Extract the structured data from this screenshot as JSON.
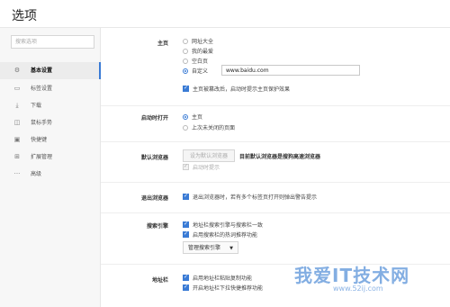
{
  "header": {
    "title": "选项"
  },
  "sidebar": {
    "search_placeholder": "搜索选项",
    "items": [
      {
        "icon": "gear-icon",
        "glyph": "⚙",
        "label": "基本设置",
        "active": true
      },
      {
        "icon": "tab-icon",
        "glyph": "▭",
        "label": "标签设置",
        "active": false
      },
      {
        "icon": "download-icon",
        "glyph": "⤓",
        "label": "下载",
        "active": false
      },
      {
        "icon": "mouse-icon",
        "glyph": "◫",
        "label": "鼠标手势",
        "active": false
      },
      {
        "icon": "keyboard-icon",
        "glyph": "▣",
        "label": "快捷键",
        "active": false
      },
      {
        "icon": "extension-icon",
        "glyph": "⊞",
        "label": "扩展管理",
        "active": false
      },
      {
        "icon": "more-icon",
        "glyph": "···",
        "label": "高级",
        "active": false
      }
    ]
  },
  "homepage": {
    "label": "主页",
    "options": [
      "网址大全",
      "我的最爱",
      "空白页",
      "自定义"
    ],
    "selected": "自定义",
    "url_value": "www.baidu.com",
    "protect_label": "主页被篡改后，启动时提示主页保护效果",
    "protect_checked": true
  },
  "startup": {
    "label": "启动时打开",
    "options": [
      "主页",
      "上次未关闭的页面"
    ],
    "selected": "主页"
  },
  "default_browser": {
    "label": "默认浏览器",
    "button_label": "设为默认浏览器",
    "status_text": "目前默认浏览器是搜狗高速浏览器",
    "startup_check_label": "启动时提示",
    "startup_check_checked": false
  },
  "exit_browser": {
    "label": "退出浏览器",
    "check_label": "退出浏览器时，若有多个标签页打开则弹出警告提示",
    "checked": true
  },
  "search_engine": {
    "label": "搜索引擎",
    "check1_label": "地址栏搜索引擎与搜索栏一致",
    "check1_checked": true,
    "check2_label": "启用搜索栏的热词推荐功能",
    "check2_checked": true,
    "manage_button": "管理搜索引擎"
  },
  "address_bar": {
    "label": "地址栏",
    "check1_label": "启用地址栏粘贴复制功能",
    "check1_checked": true,
    "check2_label": "开启地址栏下拉快捷推荐功能",
    "check2_checked": true
  },
  "watermark": {
    "text": "我爱IT技术网",
    "url": "www.52ij.com"
  }
}
